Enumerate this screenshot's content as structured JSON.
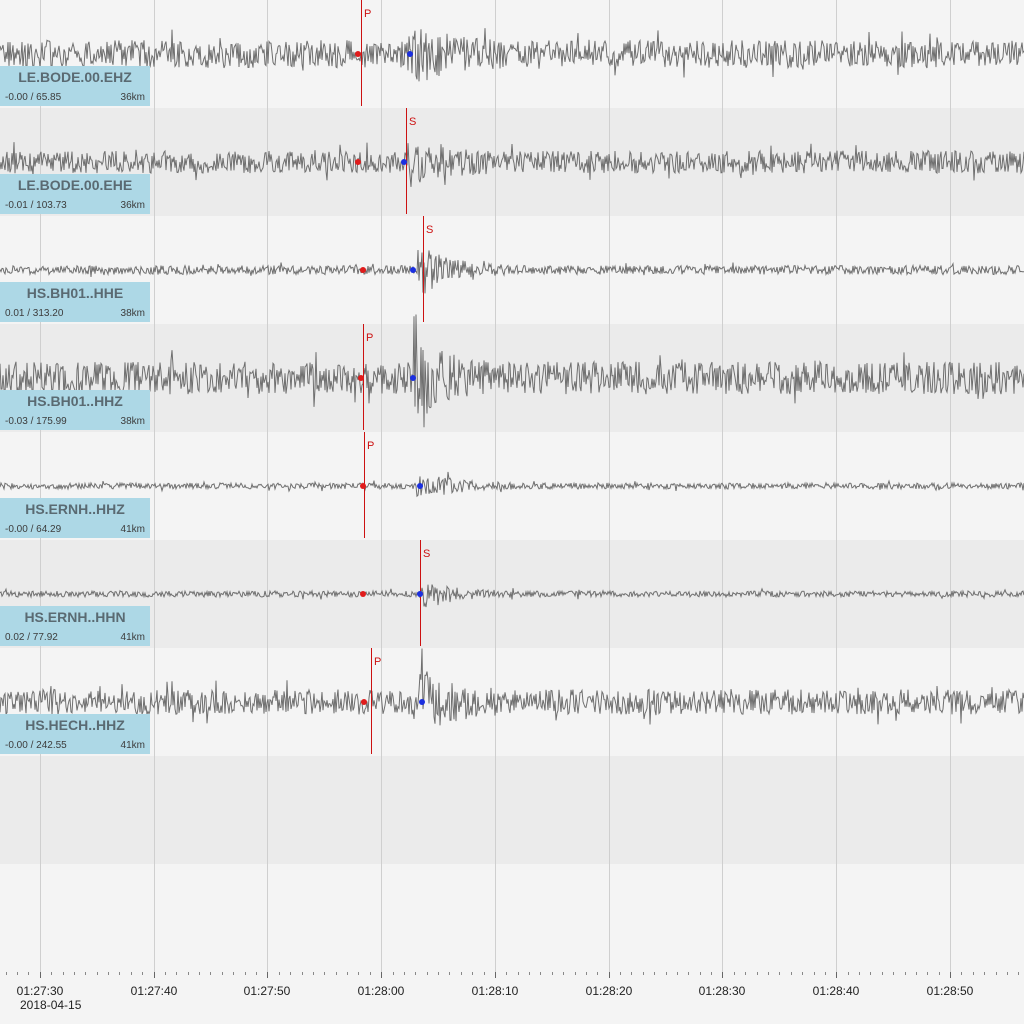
{
  "traces": [
    {
      "station": "LE.BODE.00.EHZ",
      "range": "-0.00 / 65.85",
      "distance": "36km",
      "amp": 0.55,
      "picks": [
        {
          "phase": "P",
          "time": "01:27:58.2"
        }
      ],
      "markers": [
        {
          "color": "red",
          "time": "01:27:58.0"
        },
        {
          "color": "blue",
          "time": "01:28:02.5"
        }
      ],
      "event_time": "01:28:03"
    },
    {
      "station": "LE.BODE.00.EHE",
      "range": "-0.01 / 103.73",
      "distance": "36km",
      "amp": 0.45,
      "picks": [
        {
          "phase": "S",
          "time": "01:28:02.2"
        }
      ],
      "markers": [
        {
          "color": "red",
          "time": "01:27:58.0"
        },
        {
          "color": "blue",
          "time": "01:28:02.0"
        }
      ],
      "event_time": "01:28:03"
    },
    {
      "station": "HS.BH01..HHE",
      "range": "0.01 / 313.20",
      "distance": "38km",
      "amp": 0.18,
      "picks": [
        {
          "phase": "S",
          "time": "01:28:03.7"
        }
      ],
      "markers": [
        {
          "color": "red",
          "time": "01:27:58.4"
        },
        {
          "color": "blue",
          "time": "01:28:02.8"
        }
      ],
      "event_time": "01:28:03.9"
    },
    {
      "station": "HS.BH01..HHZ",
      "range": "-0.03 / 175.99",
      "distance": "38km",
      "amp": 0.65,
      "picks": [
        {
          "phase": "P",
          "time": "01:27:58.4"
        }
      ],
      "markers": [
        {
          "color": "red",
          "time": "01:27:58.2"
        },
        {
          "color": "blue",
          "time": "01:28:02.8"
        }
      ],
      "event_time": "01:28:03.5"
    },
    {
      "station": "HS.ERNH..HHZ",
      "range": "-0.00 / 64.29",
      "distance": "41km",
      "amp": 0.12,
      "picks": [
        {
          "phase": "P",
          "time": "01:27:58.5"
        }
      ],
      "markers": [
        {
          "color": "red",
          "time": "01:27:58.4"
        },
        {
          "color": "blue",
          "time": "01:28:03.4"
        }
      ],
      "event_time": "01:28:03.8"
    },
    {
      "station": "HS.ERNH..HHN",
      "range": "0.02 / 77.92",
      "distance": "41km",
      "amp": 0.12,
      "picks": [
        {
          "phase": "S",
          "time": "01:28:03.4"
        }
      ],
      "markers": [
        {
          "color": "red",
          "time": "01:27:58.4"
        },
        {
          "color": "blue",
          "time": "01:28:03.4"
        }
      ],
      "event_time": "01:28:04"
    },
    {
      "station": "HS.HECH..HHZ",
      "range": "-0.00 / 242.55",
      "distance": "41km",
      "amp": 0.5,
      "picks": [
        {
          "phase": "P",
          "time": "01:27:59.1"
        }
      ],
      "markers": [
        {
          "color": "red",
          "time": "01:27:58.5"
        },
        {
          "color": "blue",
          "time": "01:28:03.6"
        }
      ],
      "event_time": "01:28:04"
    }
  ],
  "time_axis": {
    "start": "01:27:26.5",
    "end": "01:28:56.5",
    "tick_labels": [
      "01:27:30",
      "01:27:40",
      "01:27:50",
      "01:28:00",
      "01:28:10",
      "01:28:20",
      "01:28:30",
      "01:28:40",
      "01:28:50"
    ],
    "date": "2018-04-15"
  },
  "colors": {
    "trace": "#6f6f6f",
    "pick": "#cc1111",
    "label_bg": "#add8e6",
    "row_light": "#f4f4f4",
    "row_dark": "#ebebeb"
  }
}
